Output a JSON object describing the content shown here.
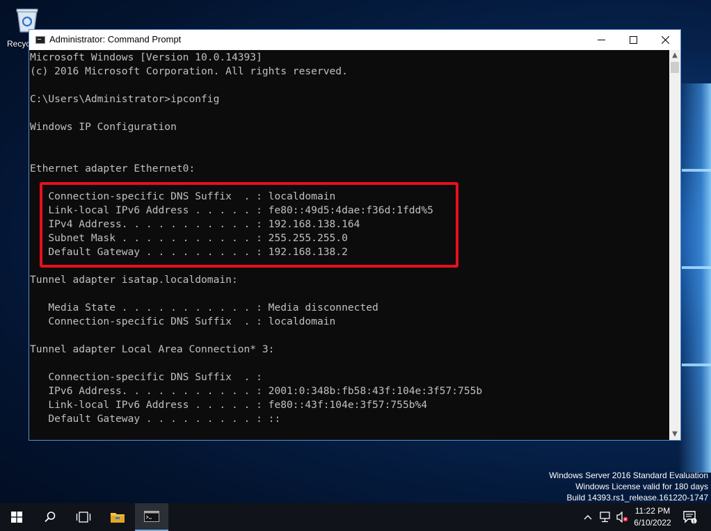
{
  "desktop": {
    "recycle_bin_label": "Recycle Bin",
    "watermark": {
      "line1": "Windows Server 2016 Standard Evaluation",
      "line2": "Windows License valid for 180 days",
      "line3": "Build 14393.rs1_release.161220-1747"
    }
  },
  "window": {
    "title": "Administrator: Command Prompt",
    "controls": {
      "minimize": "minimize",
      "maximize": "maximize",
      "close": "close"
    }
  },
  "console": {
    "lines": [
      "Microsoft Windows [Version 10.0.14393]",
      "(c) 2016 Microsoft Corporation. All rights reserved.",
      "",
      "C:\\Users\\Administrator>ipconfig",
      "",
      "Windows IP Configuration",
      "",
      "",
      "Ethernet adapter Ethernet0:",
      "",
      "   Connection-specific DNS Suffix  . : localdomain",
      "   Link-local IPv6 Address . . . . . : fe80::49d5:4dae:f36d:1fdd%5",
      "   IPv4 Address. . . . . . . . . . . : 192.168.138.164",
      "   Subnet Mask . . . . . . . . . . . : 255.255.255.0",
      "   Default Gateway . . . . . . . . . : 192.168.138.2",
      "",
      "Tunnel adapter isatap.localdomain:",
      "",
      "   Media State . . . . . . . . . . . : Media disconnected",
      "   Connection-specific DNS Suffix  . : localdomain",
      "",
      "Tunnel adapter Local Area Connection* 3:",
      "",
      "   Connection-specific DNS Suffix  . :",
      "   IPv6 Address. . . . . . . . . . . : 2001:0:348b:fb58:43f:104e:3f57:755b",
      "   Link-local IPv6 Address . . . . . : fe80::43f:104e:3f57:755b%4",
      "   Default Gateway . . . . . . . . . : ::"
    ]
  },
  "taskbar": {
    "buttons": [
      "start",
      "search",
      "task-view",
      "file-explorer",
      "command-prompt"
    ],
    "tray": {
      "notification_count": "1"
    },
    "clock": {
      "time": "11:22 PM",
      "date": "6/10/2022"
    }
  },
  "colors": {
    "console_bg": "#0c0c0c",
    "console_fg": "#c0c0c0",
    "highlight": "#e8101b",
    "taskbar_bg": "#101319"
  }
}
